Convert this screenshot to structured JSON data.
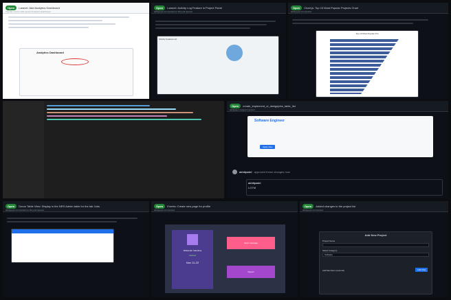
{
  "tiles": {
    "t1": {
      "badge": "Open",
      "title": "Laravel: Add Analytics Dashboard",
      "subtitle": "Tutorial: How to Add Laravel Analytics Dashboard",
      "dashboard_title": "Analytics Dashboard"
    },
    "t2": {
      "badge": "Open",
      "title": "Laravel: Activity Log Feature in Project Panel",
      "subtitle": "akhilgoyal commented on this pull request",
      "section": "Activity Feature List"
    },
    "t3": {
      "badge": "Open",
      "title": "Chart.js: Top 10 Most Popular Projects Chart",
      "subtitle": "akhilgoyal commented",
      "chart_title": "Top 10 Most Popular Pro"
    },
    "t5": {
      "badge": "Open",
      "title": "create_implement_ui_designjobs_table_list",
      "subtitle": "akhilpatel merged 1 commit",
      "card_title": "Software Engineer",
      "card_btn": "Apply Now",
      "commenter": "akhilpatel",
      "comment_text": "approved these changes now",
      "reply_name": "akhilpatel",
      "reply_label": "LGTM"
    },
    "t6": {
      "badge": "Open",
      "title": "Donor Table View: Display in the NRS Admin table for the tab Jobs",
      "subtitle": "akhilgoyal commented on this pull request"
    },
    "t7": {
      "badge": "Open",
      "title": "Events: Create new page for profile",
      "subtitle": "akhilgoyal commented",
      "profile_name": "Shikander Velantine",
      "status": "Verified",
      "joined": "Nov 11-22",
      "btn1": "Send message",
      "btn2": "Report"
    },
    "t8": {
      "badge": "Open",
      "title": "Added changes to the project list",
      "subtitle": "akhilgoyal commented",
      "modal_title": "Add New Project",
      "field_name": "Project Name",
      "field_cat": "Select Category",
      "cat_value": "Software",
      "btn_add": "Add FAQ",
      "field_members": "Add Members (optional)"
    }
  },
  "colors": {
    "open_green": "#238636",
    "bg_dark": "#0d1117",
    "link": "#58a6ff"
  }
}
